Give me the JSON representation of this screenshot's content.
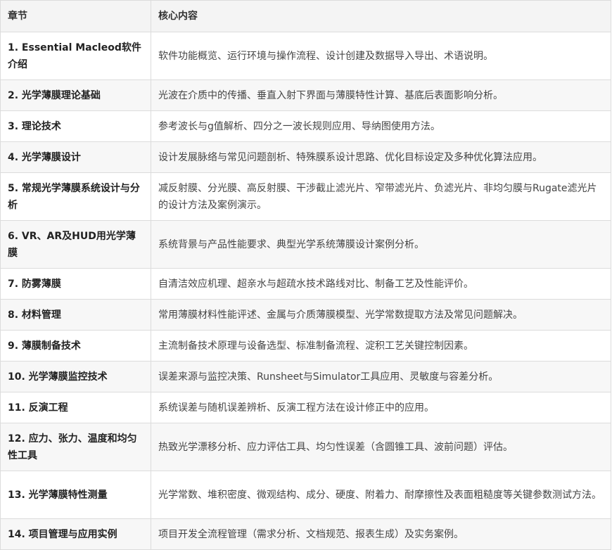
{
  "table": {
    "headers": [
      "章节",
      "核心内容"
    ],
    "rows": [
      {
        "chapter": "1. Essential Macleod软件介绍",
        "content": "软件功能概览、运行环境与操作流程、设计创建及数据导入导出、术语说明。"
      },
      {
        "chapter": "2. 光学薄膜理论基础",
        "content": "光波在介质中的传播、垂直入射下界面与薄膜特性计算、基底后表面影响分析。"
      },
      {
        "chapter": "3. 理论技术",
        "content": "参考波长与g值解析、四分之一波长规则应用、导纳图使用方法。"
      },
      {
        "chapter": "4. 光学薄膜设计",
        "content": "设计发展脉络与常见问题剖析、特殊膜系设计思路、优化目标设定及多种优化算法应用。"
      },
      {
        "chapter": "5. 常规光学薄膜系统设计与分析",
        "content": "减反射膜、分光膜、高反射膜、干涉截止滤光片、窄带滤光片、负滤光片、非均匀膜与Rugate滤光片的设计方法及案例演示。"
      },
      {
        "chapter": "6. VR、AR及HUD用光学薄膜",
        "content": "系统背景与产品性能要求、典型光学系统薄膜设计案例分析。"
      },
      {
        "chapter": "7. 防雾薄膜",
        "content": "自清洁效应机理、超亲水与超疏水技术路线对比、制备工艺及性能评价。"
      },
      {
        "chapter": "8. 材料管理",
        "content": "常用薄膜材料性能评述、金属与介质薄膜模型、光学常数提取方法及常见问题解决。"
      },
      {
        "chapter": "9. 薄膜制备技术",
        "content": "主流制备技术原理与设备选型、标准制备流程、淀积工艺关键控制因素。"
      },
      {
        "chapter": "10. 光学薄膜监控技术",
        "content": "误差来源与监控决策、Runsheet与Simulator工具应用、灵敏度与容差分析。"
      },
      {
        "chapter": "11. 反演工程",
        "content": "系统误差与随机误差辨析、反演工程方法在设计修正中的应用。"
      },
      {
        "chapter": "12. 应力、张力、温度和均匀性工具",
        "content": "热致光学漂移分析、应力评估工具、均匀性误差（含圆锥工具、波前问题）评估。"
      },
      {
        "chapter": "13. 光学薄膜特性测量",
        "content": "光学常数、堆积密度、微观结构、成分、硬度、附着力、耐摩擦性及表面粗糙度等关键参数测试方法。"
      },
      {
        "chapter": "14. 项目管理与应用实例",
        "content": "项目开发全流程管理（需求分析、文档规范、报表生成）及实务案例。"
      }
    ]
  }
}
